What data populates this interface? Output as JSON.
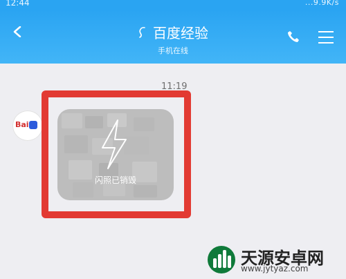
{
  "status_bar": {
    "time": "12:44",
    "network_speed": "...9.9K/s"
  },
  "header": {
    "title": "百度经验",
    "subtitle": "手机在线"
  },
  "chat": {
    "timestamp": "11:19",
    "flash_message_text": "闪照已销毁",
    "avatar_brand_text": "Bai"
  },
  "watermark": {
    "title": "天源安卓网",
    "url": "www.jytyaz.com"
  },
  "colors": {
    "header_blue": "#2aa4f2",
    "highlight_red": "#e23a33",
    "background": "#eeeef2"
  }
}
